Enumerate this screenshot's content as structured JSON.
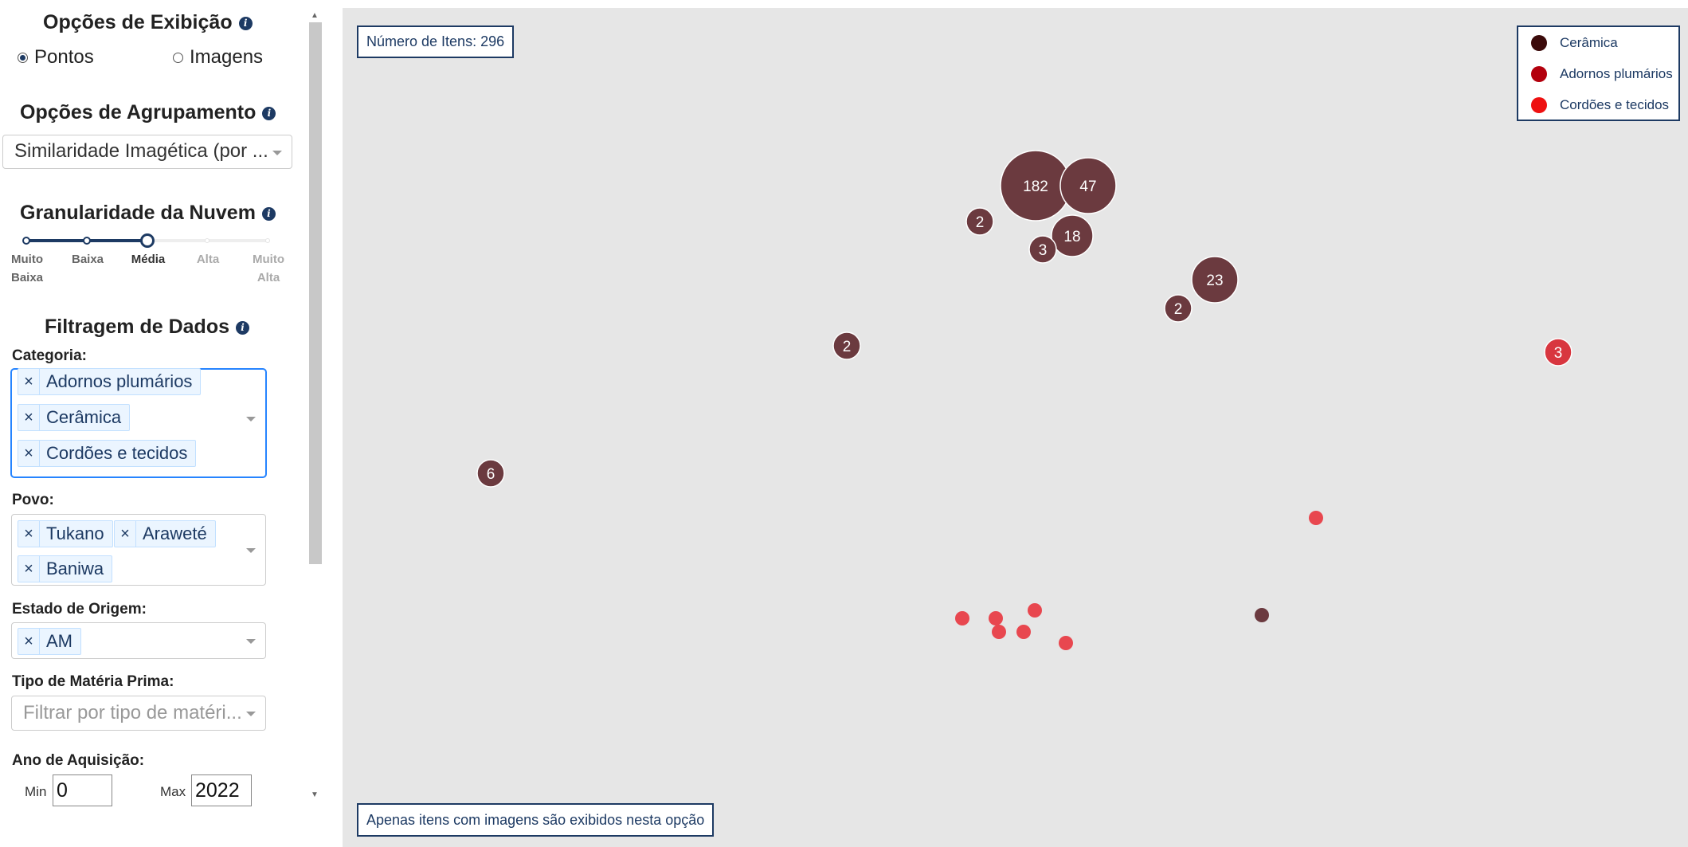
{
  "display_options": {
    "title": "Opções de Exibição",
    "options": [
      {
        "label": "Pontos",
        "selected": true
      },
      {
        "label": "Imagens",
        "selected": false
      }
    ]
  },
  "grouping_options": {
    "title": "Opções de Agrupamento",
    "selected": "Similaridade Imagética (por ..."
  },
  "granularity": {
    "title": "Granularidade da Nuvem",
    "levels": [
      "Muito Baixa",
      "Baixa",
      "Média",
      "Alta",
      "Muito Alta"
    ],
    "selected_index": 2
  },
  "filtering": {
    "title": "Filtragem de Dados",
    "categoria": {
      "label": "Categoria:",
      "tags": [
        "Adornos plumários",
        "Cerâmica",
        "Cordões e tecidos"
      ]
    },
    "povo": {
      "label": "Povo:",
      "tags": [
        "Tukano",
        "Araweté",
        "Baniwa"
      ]
    },
    "estado": {
      "label": "Estado de Origem:",
      "tags": [
        "AM"
      ]
    },
    "materia": {
      "label": "Tipo de Matéria Prima:",
      "placeholder": "Filtrar por tipo de matéri..."
    },
    "ano": {
      "label": "Ano de Aquisição:",
      "min_label": "Min",
      "min_value": "0",
      "max_label": "Max",
      "max_value": "2022"
    }
  },
  "plot": {
    "item_count": "Número de Itens: 296",
    "footer_note": "Apenas itens com imagens são exibidos nesta opção",
    "legend": [
      {
        "label": "Cerâmica",
        "color": "#3b0a0a"
      },
      {
        "label": "Adornos plumários",
        "color": "#b3000d"
      },
      {
        "label": "Cordões e tecidos",
        "color": "#ee1111"
      }
    ],
    "clusters": [
      {
        "label": "182",
        "group": "Cerâmica"
      },
      {
        "label": "47",
        "group": "Cerâmica"
      },
      {
        "label": "18",
        "group": "Cerâmica"
      },
      {
        "label": "2",
        "group": "Cerâmica"
      },
      {
        "label": "3",
        "group": "Cerâmica"
      },
      {
        "label": "23",
        "group": "Cerâmica"
      },
      {
        "label": "2",
        "group": "Cerâmica"
      },
      {
        "label": "2",
        "group": "Cerâmica"
      },
      {
        "label": "6",
        "group": "Cerâmica"
      },
      {
        "label": "3",
        "group": "Cordões e tecidos"
      }
    ],
    "cluster_fill": "#6b3a3f",
    "point_fill": "#e8474f",
    "label_color": "#ffffff"
  }
}
